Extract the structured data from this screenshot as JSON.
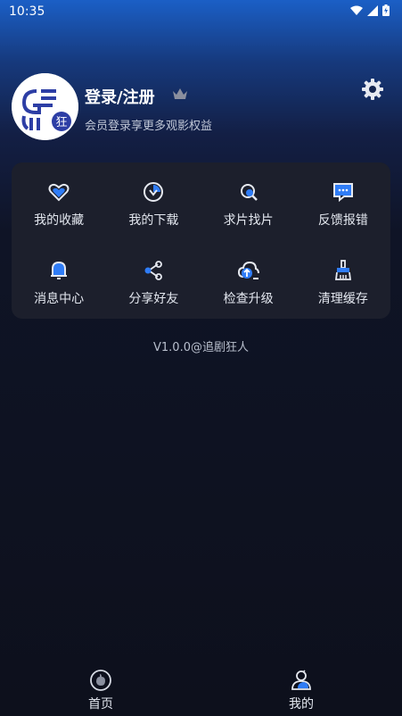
{
  "status_bar": {
    "time": "10:35"
  },
  "profile": {
    "login_label": "登录/注册",
    "subtitle": "会员登录享更多观影权益",
    "avatar_text": "狂"
  },
  "features": [
    {
      "label": "我的收藏",
      "icon": "heart-icon"
    },
    {
      "label": "我的下载",
      "icon": "download-icon"
    },
    {
      "label": "求片找片",
      "icon": "search-film-icon"
    },
    {
      "label": "反馈报错",
      "icon": "feedback-icon"
    },
    {
      "label": "消息中心",
      "icon": "bell-icon"
    },
    {
      "label": "分享好友",
      "icon": "share-icon"
    },
    {
      "label": "检查升级",
      "icon": "cloud-upgrade-icon"
    },
    {
      "label": "清理缓存",
      "icon": "broom-icon"
    }
  ],
  "version": "V1.0.0@追剧狂人",
  "bottom_nav": {
    "home_label": "首页",
    "mine_label": "我的"
  },
  "colors": {
    "accent": "#2f7cf6",
    "card": "#1c1f2c"
  }
}
